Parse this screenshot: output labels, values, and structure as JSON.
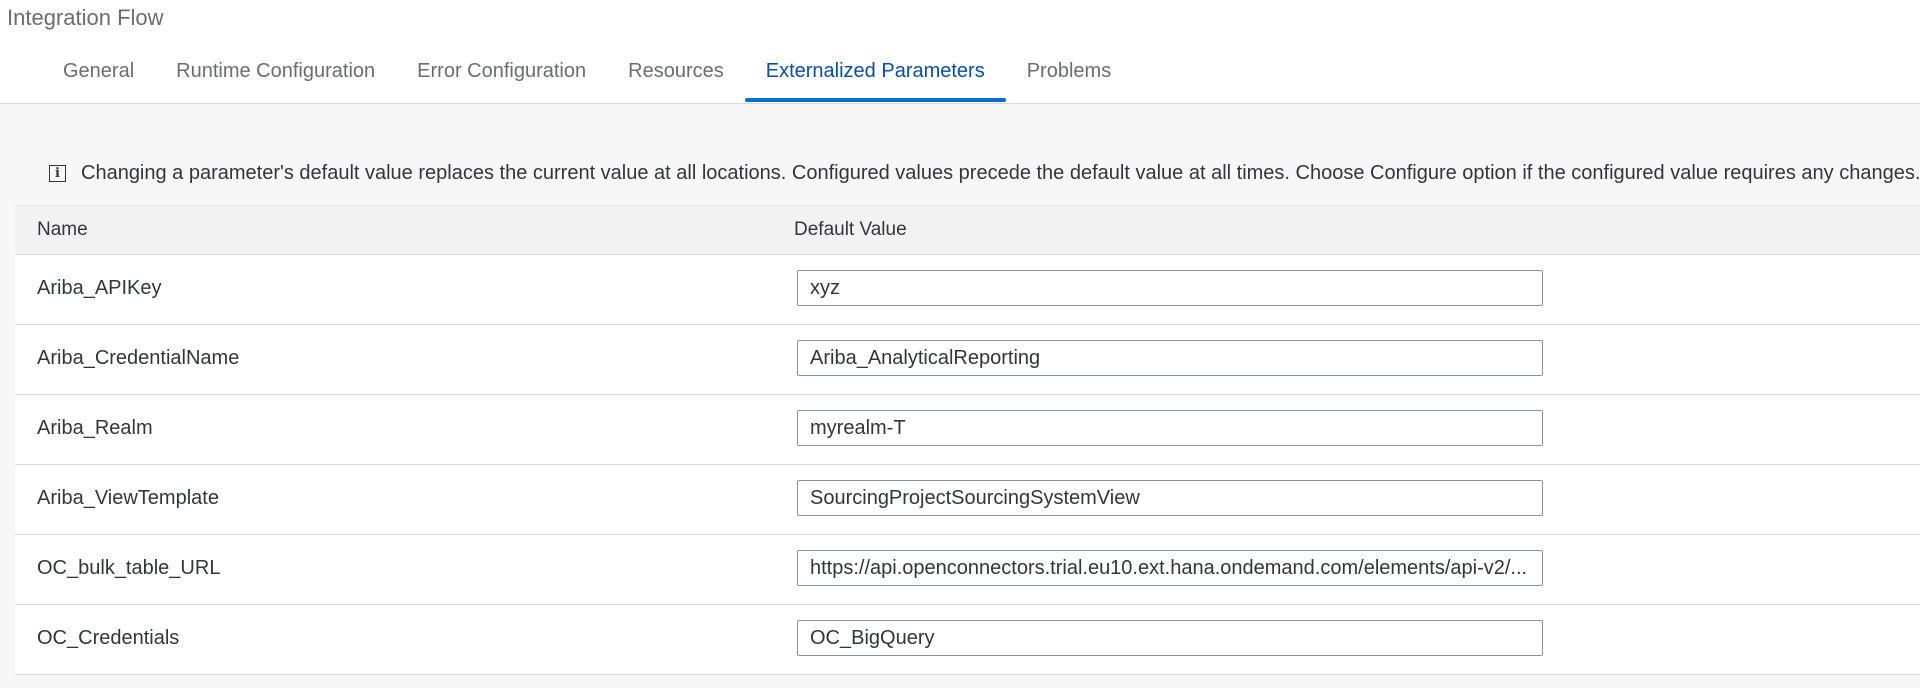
{
  "header": {
    "title": "Integration Flow",
    "tabs": [
      {
        "label": "General"
      },
      {
        "label": "Runtime Configuration"
      },
      {
        "label": "Error Configuration"
      },
      {
        "label": "Resources"
      },
      {
        "label": "Externalized Parameters"
      },
      {
        "label": "Problems"
      }
    ],
    "active_tab": "Externalized Parameters"
  },
  "info": {
    "icon": "info-icon",
    "text": "Changing a parameter's default value replaces the current value at all locations. Configured values precede the default value at all times. Choose Configure option if the configured value requires any changes."
  },
  "table": {
    "columns": {
      "name": "Name",
      "default_value": "Default Value"
    },
    "rows": [
      {
        "name": "Ariba_APIKey",
        "value": "xyz"
      },
      {
        "name": "Ariba_CredentialName",
        "value": "Ariba_AnalyticalReporting"
      },
      {
        "name": "Ariba_Realm",
        "value": "myrealm-T"
      },
      {
        "name": "Ariba_ViewTemplate",
        "value": "SourcingProjectSourcingSystemView"
      },
      {
        "name": "OC_bulk_table_URL",
        "value": "https://api.openconnectors.trial.eu10.ext.hana.ondemand.com/elements/api-v2/..."
      },
      {
        "name": "OC_Credentials",
        "value": "OC_BigQuery"
      }
    ]
  },
  "colors": {
    "accent": "#0a6ed1",
    "active_tab_text": "#0a4da3"
  }
}
